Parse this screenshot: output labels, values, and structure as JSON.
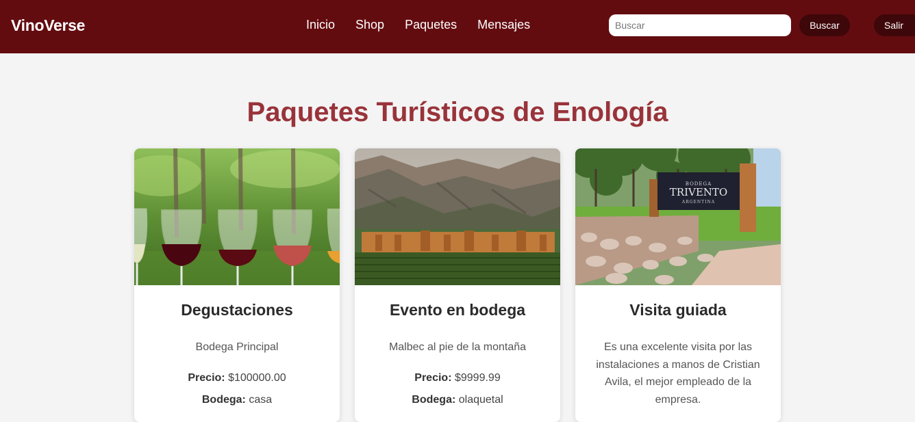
{
  "navbar": {
    "brand": "VinoVerse",
    "links": [
      "Inicio",
      "Shop",
      "Paquetes",
      "Mensajes"
    ],
    "search_placeholder": "Buscar",
    "search_button": "Buscar",
    "logout_button": "Salir"
  },
  "page": {
    "title": "Paquetes Turísticos de Enología"
  },
  "labels": {
    "price": "Precio:",
    "bodega": "Bodega:"
  },
  "packages": [
    {
      "title": "Degustaciones",
      "description": "Bodega Principal",
      "price": "$100000.00",
      "bodega": "casa",
      "image": "wine-glasses-vineyard"
    },
    {
      "title": "Evento en bodega",
      "description": "Malbec al pie de la montaña",
      "price": "$9999.99",
      "bodega": "olaquetal",
      "image": "winery-mountains"
    },
    {
      "title": "Visita guiada",
      "description": "Es una excelente visita por las instalaciones a manos de Cristian Avila, el mejor empleado de la empresa.",
      "image": "trivento-sign"
    }
  ],
  "sign": {
    "top": "BODEGA",
    "main": "TRIVENTO",
    "sub": "ARGENTINA"
  },
  "colors": {
    "navbar": "#630c10",
    "button": "#3e070a",
    "title": "#99333a",
    "background": "#f4f4f4"
  }
}
